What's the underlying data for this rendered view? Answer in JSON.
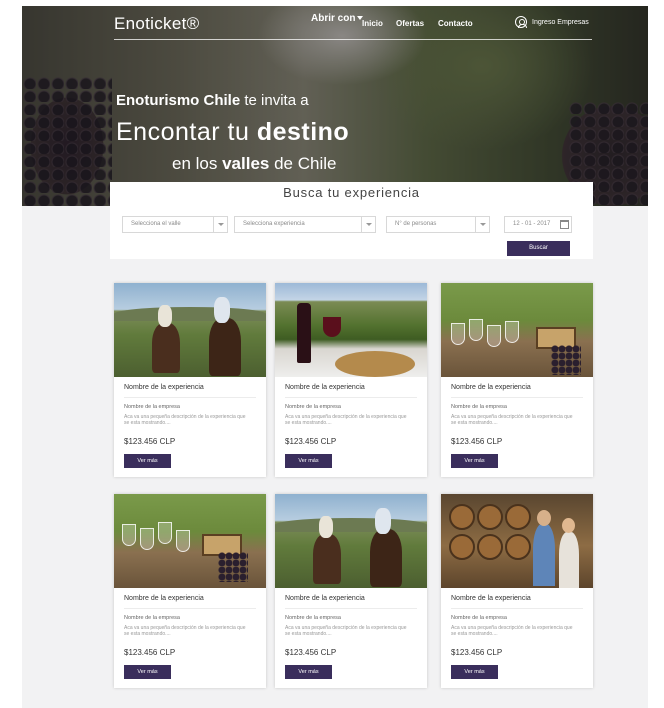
{
  "header": {
    "logo": "Enoticket®",
    "filter_label": "Abrir con",
    "nav": [
      "Inicio",
      "Ofertas",
      "Contacto"
    ],
    "login_label": "Ingreso Empresas"
  },
  "hero": {
    "line1_bold": "Enoturismo Chile",
    "line1_rest": " te invita a",
    "line2_pre": "Encontar tu ",
    "line2_bold": "destino",
    "line3_pre": "en los ",
    "line3_bold": "valles",
    "line3_post": " de Chile"
  },
  "search": {
    "title": "Busca tu experiencia",
    "valle_placeholder": "Selecciona el valle",
    "experiencia_placeholder": "Selecciona experiencia",
    "personas_placeholder": "N° de personas",
    "fecha_value": "12 - 01 - 2017",
    "button_label": "Buscar"
  },
  "cards": [
    {
      "name": "Nombre de la experiencia",
      "company": "Nombre de la empresa",
      "desc": "Aca va una pequeña descripción de la experiencia que se esta mostrando....",
      "price": "$123.456 CLP",
      "button": "Ver más",
      "photo": "horses-vineyard"
    },
    {
      "name": "Nombre de la experiencia",
      "company": "Nombre de la empresa",
      "desc": "Aca va una pequeña descripción de la experiencia que se esta mostrando....",
      "price": "$123.456 CLP",
      "button": "Ver más",
      "photo": "wine-table"
    },
    {
      "name": "Nombre de la experiencia",
      "company": "Nombre de la empresa",
      "desc": "Aca va una pequeña descripción de la experiencia que se esta mostrando....",
      "price": "$123.456 CLP",
      "button": "Ver más",
      "photo": "wine-glasses"
    },
    {
      "name": "Nombre de la experiencia",
      "company": "Nombre de la empresa",
      "desc": "Aca va una pequeña descripción de la experiencia que se esta mostrando....",
      "price": "$123.456 CLP",
      "button": "Ver más",
      "photo": "wine-glasses"
    },
    {
      "name": "Nombre de la experiencia",
      "company": "Nombre de la empresa",
      "desc": "Aca va una pequeña descripción de la experiencia que se esta mostrando....",
      "price": "$123.456 CLP",
      "button": "Ver más",
      "photo": "horses-vineyard"
    },
    {
      "name": "Nombre de la experiencia",
      "company": "Nombre de la empresa",
      "desc": "Aca va una pequeña descripción de la experiencia que se esta mostrando....",
      "price": "$123.456 CLP",
      "button": "Ver más",
      "photo": "wine-cellar"
    }
  ],
  "colors": {
    "accent": "#3a2e5c",
    "page_bg": "#f2f2f3"
  }
}
